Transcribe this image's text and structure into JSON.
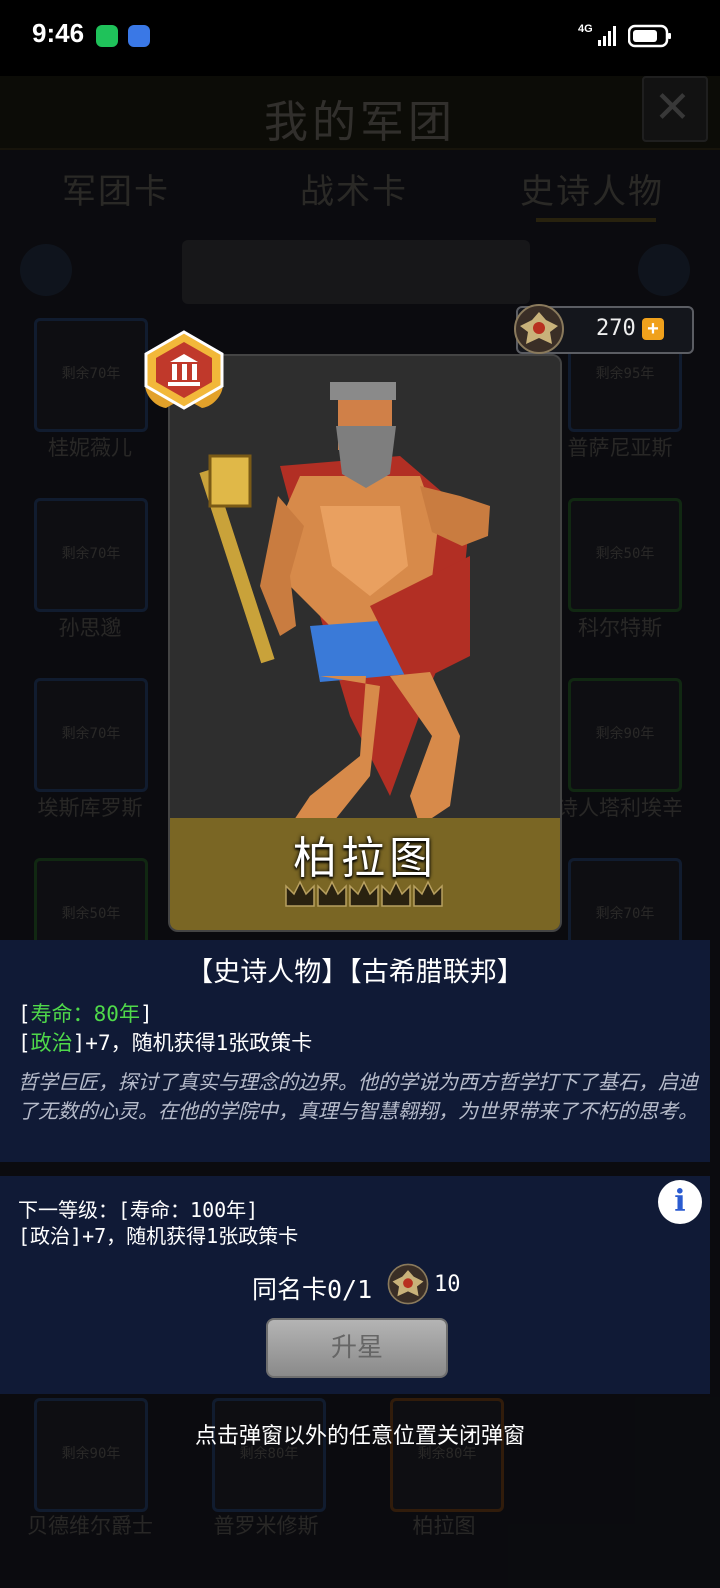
{
  "status_bar": {
    "time": "9:46",
    "network": "4G",
    "icons": [
      "wechat-icon",
      "app-icon",
      "signal-icon",
      "battery-icon"
    ]
  },
  "background": {
    "title": "我的军团",
    "tabs": [
      "军团卡",
      "战术卡",
      "史诗人物"
    ],
    "cards": [
      {
        "remaining": "剩余70年",
        "name": "桂妮薇儿"
      },
      {
        "remaining": "剩余95年",
        "name": "普萨尼亚斯"
      },
      {
        "remaining": "剩余70年",
        "name": "孙思邈"
      },
      {
        "remaining": "剩余50年",
        "name": "科尔特斯"
      },
      {
        "remaining": "剩余70年",
        "name": "埃斯库罗斯"
      },
      {
        "remaining": "剩余90年",
        "name": "诗人塔利埃辛"
      },
      {
        "remaining": "剩余50年",
        "name": ""
      },
      {
        "remaining": "剩余70年",
        "name": ""
      },
      {
        "remaining": "剩余90年",
        "name": "贝德维尔爵士"
      },
      {
        "remaining": "剩余80年",
        "name": "普罗米修斯"
      },
      {
        "remaining": "剩余80年",
        "name": "柏拉图"
      }
    ]
  },
  "currency": {
    "value": "270",
    "plus": "+"
  },
  "character": {
    "name": "柏拉图",
    "tags": "【史诗人物】【古希腊联邦】",
    "lifespan_open": "[",
    "lifespan": "寿命：80年",
    "lifespan_close": "]",
    "politics_open": "[",
    "politics": "政治",
    "politics_rest": "]+7，随机获得1张政策卡",
    "lore": "哲学巨匠，探讨了真实与理念的边界。他的学说为西方哲学打下了基石，启迪了无数的心灵。在他的学院中，真理与智慧翱翔，为世界带来了不朽的思考。"
  },
  "next_level": {
    "label": "下一等级：[寿命：100年]",
    "attr": "[政治]+7，随机获得1张政策卡"
  },
  "duplicates": {
    "label": "同名卡0/1",
    "count": "10"
  },
  "upgrade_button": "升星",
  "close_hint": "点击弹窗以外的任意位置关闭弹窗",
  "colors": {
    "accent_gold": "#f0a11c",
    "panel_bg": "#101a36",
    "attr_green": "#4fd94a"
  }
}
